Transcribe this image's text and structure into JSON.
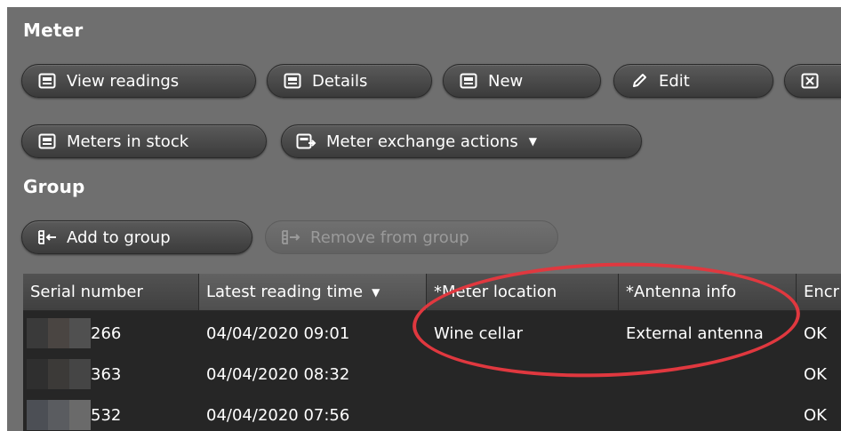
{
  "meter": {
    "title": "Meter",
    "buttons": [
      {
        "label": "View readings",
        "icon": "meter-icon"
      },
      {
        "label": "Details",
        "icon": "meter-icon"
      },
      {
        "label": "New",
        "icon": "meter-icon"
      },
      {
        "label": "Edit",
        "icon": "pencil-icon"
      },
      {
        "label": "",
        "icon": "delete-box-icon"
      },
      {
        "label": "Meters in stock",
        "icon": "meter-icon"
      },
      {
        "label": "Meter exchange actions",
        "icon": "meter-exchange-icon"
      }
    ]
  },
  "group": {
    "title": "Group",
    "add_label": "Add to group",
    "remove_label": "Remove from group"
  },
  "grid": {
    "columns": [
      "Serial number",
      "Latest reading time",
      "*Meter location",
      "*Antenna info",
      "Encr"
    ],
    "rows": [
      {
        "serial": "266",
        "time": "04/04/2020 09:01",
        "location": "Wine cellar",
        "antenna": "External antenna",
        "enc": "OK"
      },
      {
        "serial": "363",
        "time": "04/04/2020 08:32",
        "location": "",
        "antenna": "",
        "enc": "OK"
      },
      {
        "serial": "532",
        "time": "04/04/2020 07:56",
        "location": "",
        "antenna": "",
        "enc": "OK"
      }
    ]
  },
  "colors": {
    "background": "#6f6f6f",
    "grid_background": "#262626",
    "highlight": "#e0383f"
  }
}
